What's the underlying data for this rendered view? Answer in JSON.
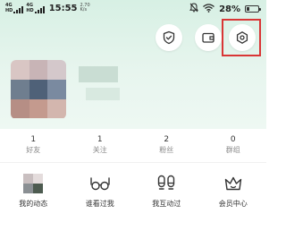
{
  "status_bar": {
    "signal_1_label": "4G",
    "signal_1_sub": "HD",
    "signal_2_label": "4G",
    "signal_2_sub": "HD",
    "time": "15:55",
    "net_speed_value": "2.70",
    "net_speed_unit": "K/s",
    "battery_percent": "28%",
    "battery_level": 0.28,
    "icons": [
      "silent-bell-icon",
      "wifi-icon",
      "battery-icon"
    ]
  },
  "top_actions": [
    {
      "name": "security-shield-icon"
    },
    {
      "name": "wallet-icon"
    },
    {
      "name": "settings-icon"
    }
  ],
  "profile": {
    "avatar": "blurred-avatar",
    "name": "",
    "id": ""
  },
  "stats": [
    {
      "value": "1",
      "label": "好友"
    },
    {
      "value": "1",
      "label": "关注"
    },
    {
      "value": "2",
      "label": "粉丝"
    },
    {
      "value": "0",
      "label": "群组"
    }
  ],
  "features": [
    {
      "label": "我的动态",
      "icon": "my-moments-thumbnail"
    },
    {
      "label": "谁看过我",
      "icon": "glasses-icon"
    },
    {
      "label": "我互动过",
      "icon": "footprints-icon"
    },
    {
      "label": "会员中心",
      "icon": "crown-icon"
    }
  ],
  "colors": {
    "header_gradient_top": "#d7f0e4",
    "header_gradient_bottom": "#eef8f3",
    "highlight_box": "#d93636",
    "text_primary": "#333333",
    "text_secondary": "#888888"
  }
}
